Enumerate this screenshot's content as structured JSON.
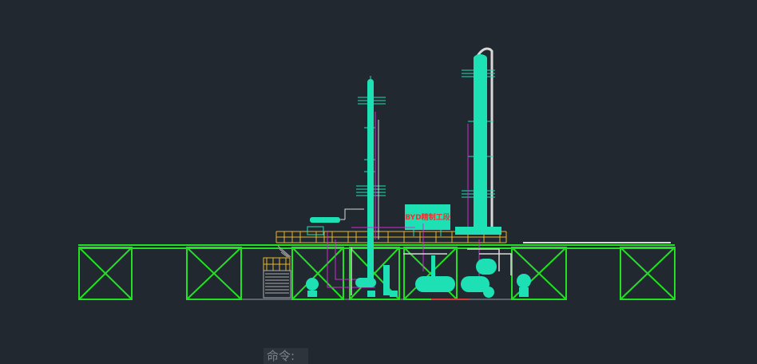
{
  "drawing": {
    "signboard_text": "BYD精制工段"
  },
  "command_line": {
    "prompt": "命令:"
  },
  "colors": {
    "background": "#212830",
    "equipment": "#1de1b4",
    "steel_frame": "#22e022",
    "platform": "#e7b629",
    "pipe": "#d42ad4",
    "label_text": "#ff2a2a"
  }
}
